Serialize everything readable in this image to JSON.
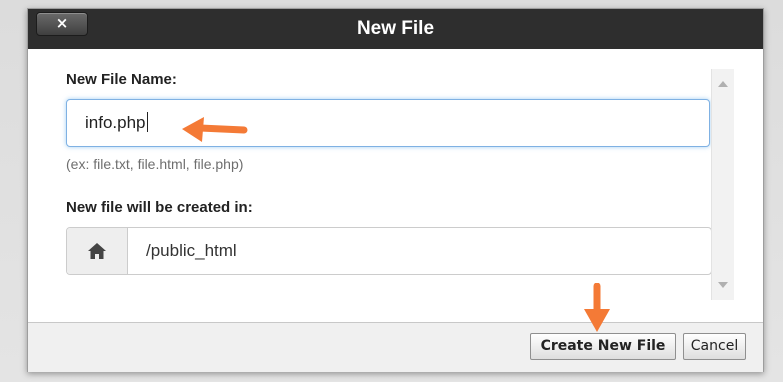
{
  "dialog": {
    "title": "New File",
    "close_label": "×"
  },
  "form": {
    "name_label": "New File Name:",
    "name_value": "info.php",
    "name_hint": "(ex: file.txt, file.html, file.php)",
    "dir_label": "New file will be created in:",
    "dir_value": "/public_html"
  },
  "footer": {
    "create_label": "Create New File",
    "cancel_label": "Cancel"
  },
  "colors": {
    "accent_arrow": "#f47a36",
    "titlebar": "#2e2e2e",
    "focus_border": "#7fb1e3"
  },
  "icons": {
    "home": "home-icon",
    "arrow": "pointer-arrow-annotation"
  }
}
